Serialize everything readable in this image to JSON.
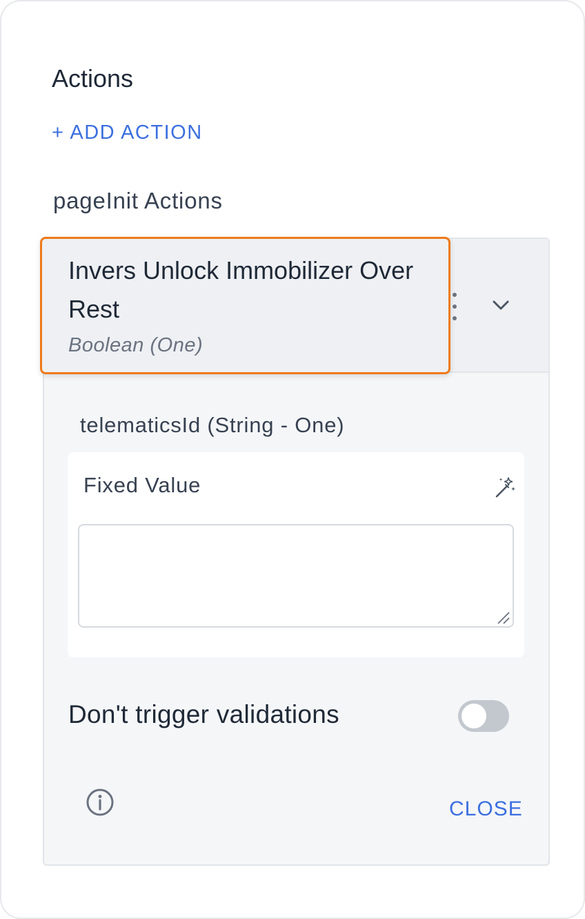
{
  "panel": {
    "title": "Actions",
    "add_action_label": "+ ADD ACTION",
    "group_title": "pageInit Actions"
  },
  "action": {
    "name": "Invers Unlock Immobilizer Over Rest",
    "type": "Boolean (One)",
    "parameter": {
      "label": "telematicsId (String - One)",
      "value_label": "Fixed Value",
      "value": ""
    },
    "validations_toggle": {
      "label": "Don't trigger validations",
      "enabled": false
    },
    "close_label": "CLOSE"
  },
  "colors": {
    "accent": "#3b6fe0",
    "highlight_border": "#ee7a1a",
    "toggle_off": "#c3c8cf"
  }
}
